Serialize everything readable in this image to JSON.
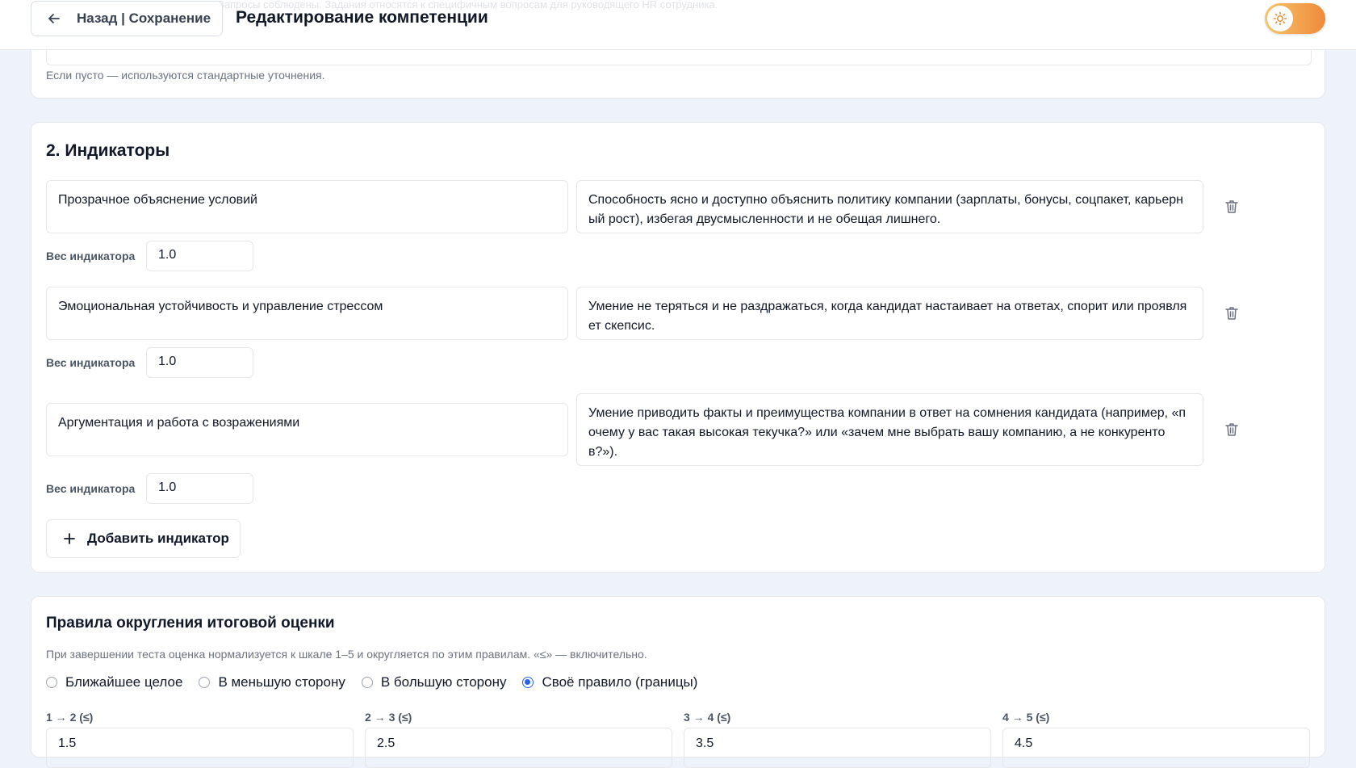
{
  "header": {
    "back_label": "Назад | Сохранение",
    "title": "Редактирование компетенции",
    "ghost_text": "Запросы соблюдены. Задания относятся к специфичным вопросам для руководящего HR сотрудника."
  },
  "refinements": {
    "hint": "Если пусто — используются стандартные уточнения."
  },
  "indicators": {
    "title": "2. Индикаторы",
    "weight_label": "Вес индикатора",
    "items": [
      {
        "name": "Прозрачное объяснение условий",
        "description": "Способность ясно и доступно объяснить политику компании (зарплаты, бонусы, соцпакет, карьерный рост), избегая двусмысленности и не обещая лишнего.",
        "weight": "1.0"
      },
      {
        "name": "Эмоциональная устойчивость и управление стрессом",
        "description": "Умение не теряться и не раздражаться, когда кандидат настаивает на ответах, спорит или проявляет скепсис.",
        "weight": "1.0"
      },
      {
        "name": "Аргументация и работа с возражениями",
        "description": "Умение приводить факты и преимущества компании в ответ на сомнения кандидата (например, «почему у вас такая высокая текучка?» или «зачем мне выбрать вашу компанию, а не конкурентов?»).",
        "weight": "1.0"
      }
    ],
    "add_label": "Добавить индикатор"
  },
  "rounding": {
    "title": "Правила округления итоговой оценки",
    "hint": "При завершении теста оценка нормализуется к шкале 1–5 и округляется по этим правилам. «≤» — включительно.",
    "options": [
      "Ближайшее целое",
      "В меньшую сторону",
      "В большую сторону",
      "Своё правило (границы)"
    ],
    "selected_index": 3,
    "bounds": [
      {
        "label": "1 → 2 (≤)",
        "value": "1.5"
      },
      {
        "label": "2 → 3 (≤)",
        "value": "2.5"
      },
      {
        "label": "3 → 4 (≤)",
        "value": "3.5"
      },
      {
        "label": "4 → 5 (≤)",
        "value": "4.5"
      }
    ]
  },
  "colors": {
    "accent": "#2563eb",
    "toggle_from": "#f7c46a",
    "toggle_to": "#ef8a3a",
    "page_bg": "#eef2fb"
  }
}
